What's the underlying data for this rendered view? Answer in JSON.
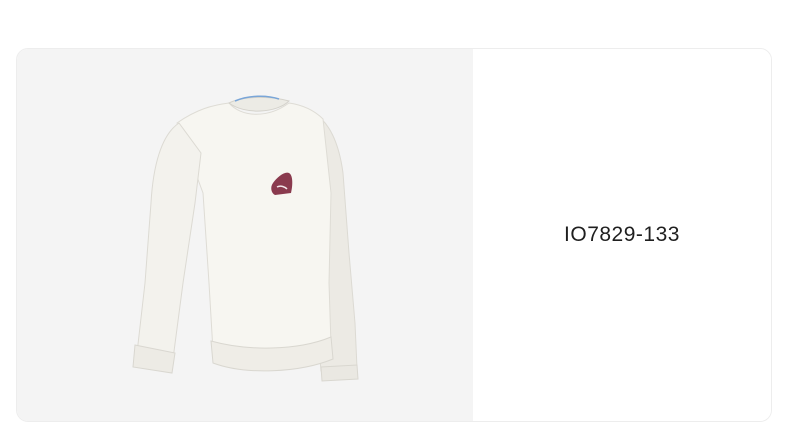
{
  "product": {
    "sku": "IO7829-133",
    "image_icon": "white-crewneck-sweatshirt-icon",
    "colors": {
      "image_background": "#f4f4f4",
      "garment": "#f7f6f1",
      "logo": "#8a3a4e"
    }
  }
}
